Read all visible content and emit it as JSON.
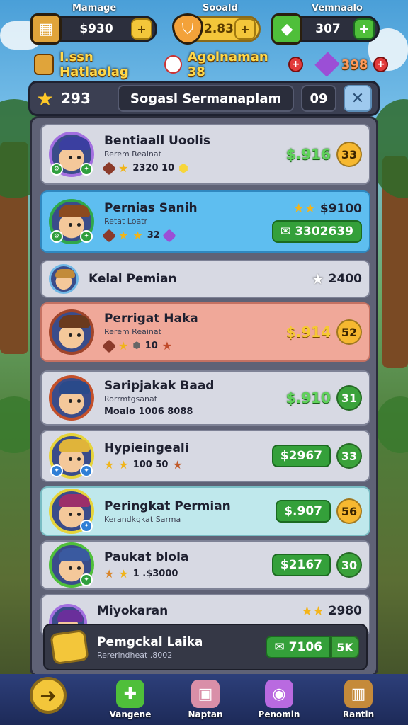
{
  "resources": [
    {
      "label": "Mamage",
      "value": "$930",
      "icon": "gold-crate-icon",
      "accent": "#f3c63a"
    },
    {
      "label": "Sooald",
      "value": "2.83",
      "icon": "shield-icon",
      "accent": "#f3c63a"
    },
    {
      "label": "Vemnaalo",
      "value": "307",
      "icon": "green-gem-icon",
      "accent": "#4fbf3a"
    }
  ],
  "event_bar": {
    "left_text": "I.ssn Hatlaolag",
    "right_text": "Agolnaman 38",
    "right_value": "398"
  },
  "header": {
    "score": "293",
    "title": "Sogasl Sermanaplam",
    "count": "09",
    "close": "✕"
  },
  "rows": [
    {
      "name": "Bentiaall Uoolis",
      "sub": "Rerem Reainat",
      "stats": "2320  10",
      "money": "$.916",
      "coin": "33",
      "coin_color": "gold",
      "style": "grey"
    },
    {
      "name": "Pernias Sanih",
      "sub": "Retat Loatr",
      "stats": "32",
      "stars_value": "$9100",
      "button": "3302639",
      "style": "blue"
    },
    {
      "name": "Kelal Pemian",
      "right_value": "2400",
      "style": "grey"
    },
    {
      "name": "Perrigat Haka",
      "sub": "Rerem Reainat",
      "stats": "10",
      "money": "$.914",
      "coin": "52",
      "coin_color": "gold",
      "style": "peach"
    },
    {
      "name": "Saripjakak Baad",
      "sub": "Rorrmtgsanat",
      "stats": "Moalo 1006  8088",
      "money": "$.910",
      "coin": "31",
      "coin_color": "green",
      "style": "grey"
    },
    {
      "name": "Hypieingeali",
      "stats": "100  50",
      "button": "$2967",
      "coin": "33",
      "coin_color": "green",
      "style": "grey"
    },
    {
      "name": "Peringkat Permian",
      "sub": "Kerandkgkat  Sarma",
      "button": "$.907",
      "coin": "56",
      "coin_color": "gold",
      "style": "mint"
    },
    {
      "name": "Paukat blola",
      "stats": "1 .$3000",
      "button": "$2167",
      "coin": "30",
      "coin_color": "green",
      "style": "grey"
    },
    {
      "name": "Miyokaran",
      "stars_value": "2980",
      "style": "grey"
    },
    {
      "name": "Pemgckal Laika",
      "sub": "Rererindheat  .8002",
      "button": "7106",
      "coin": "5K",
      "coin_color": "green",
      "style": "dark"
    }
  ],
  "nav": [
    {
      "label": "Vangene",
      "icon": "controller-icon"
    },
    {
      "label": "Naptan",
      "icon": "treasure-box-icon"
    },
    {
      "label": "Penomin",
      "icon": "shop-icon"
    },
    {
      "label": "Rantin",
      "icon": "menu-book-icon"
    }
  ]
}
